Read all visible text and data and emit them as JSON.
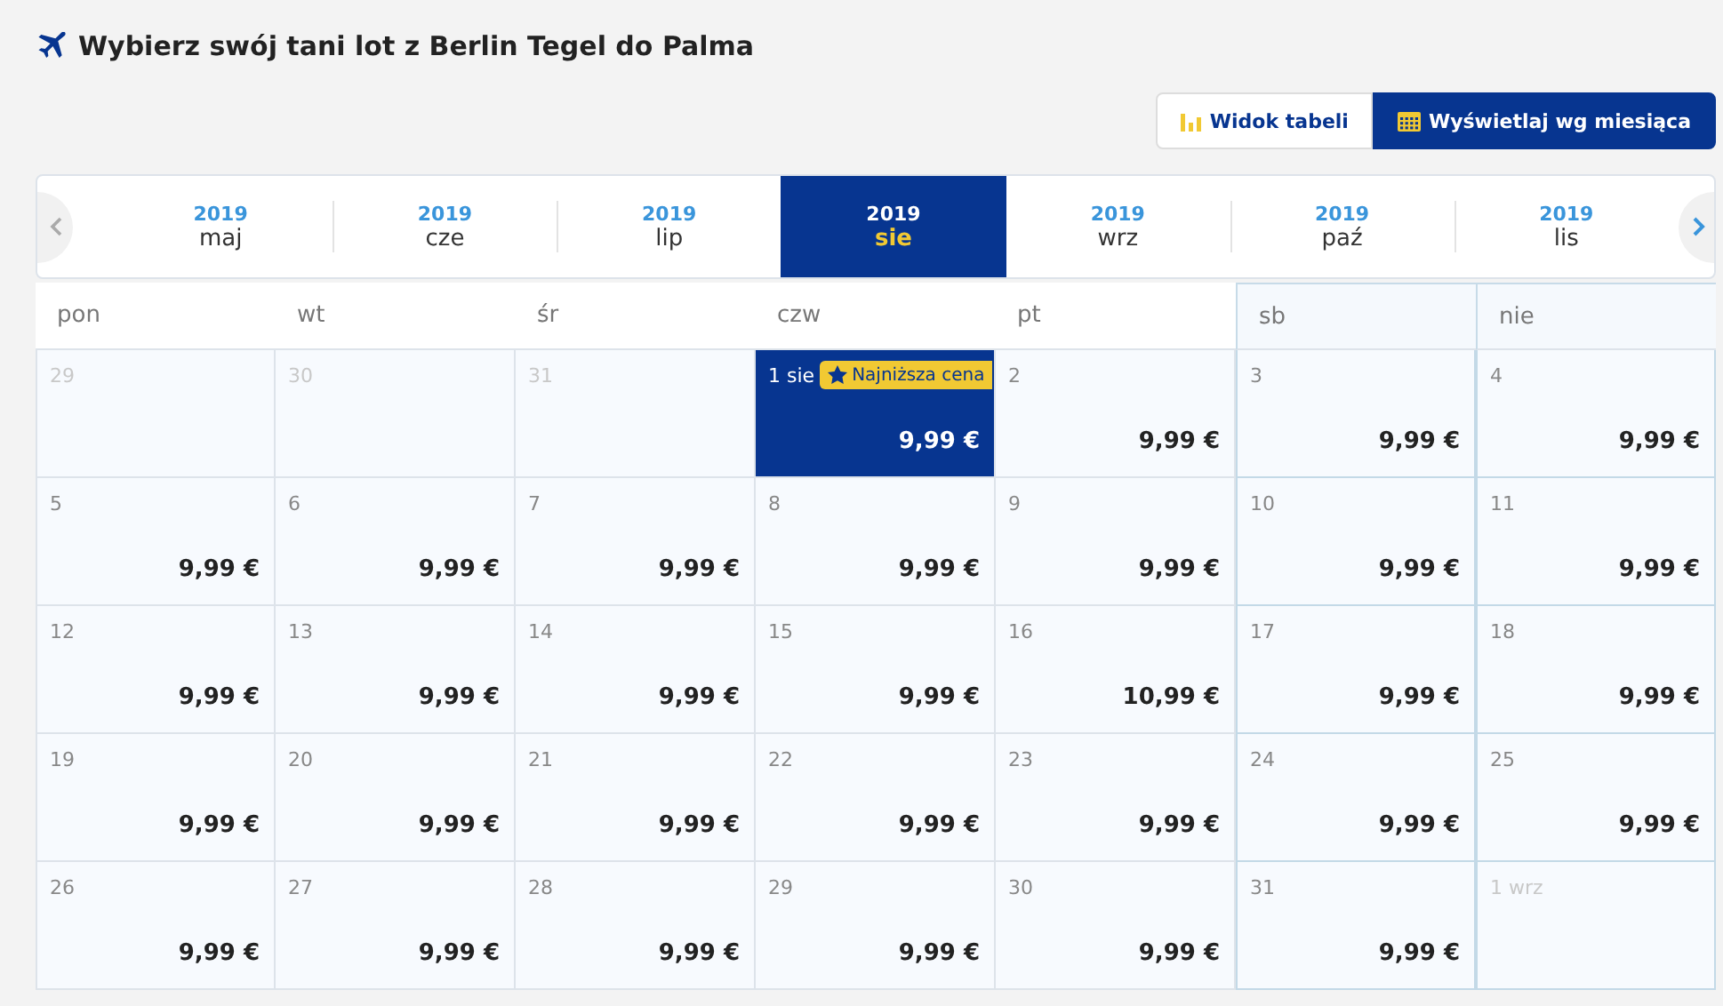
{
  "title": "Wybierz swój tani lot z Berlin Tegel do Palma",
  "view_toggle": [
    {
      "label": "Widok tabeli",
      "kind": "chart",
      "selected": false
    },
    {
      "label": "Wyświetlaj wg miesiąca",
      "kind": "calendar",
      "selected": true
    }
  ],
  "months": [
    {
      "year": "2019",
      "month": "maj",
      "selected": false
    },
    {
      "year": "2019",
      "month": "cze",
      "selected": false
    },
    {
      "year": "2019",
      "month": "lip",
      "selected": false
    },
    {
      "year": "2019",
      "month": "sie",
      "selected": true
    },
    {
      "year": "2019",
      "month": "wrz",
      "selected": false
    },
    {
      "year": "2019",
      "month": "paź",
      "selected": false
    },
    {
      "year": "2019",
      "month": "lis",
      "selected": false
    }
  ],
  "weekdays": [
    {
      "label": "pon",
      "weekend": false
    },
    {
      "label": "wt",
      "weekend": false
    },
    {
      "label": "śr",
      "weekend": false
    },
    {
      "label": "czw",
      "weekend": false
    },
    {
      "label": "pt",
      "weekend": false
    },
    {
      "label": "sb",
      "weekend": true
    },
    {
      "label": "nie",
      "weekend": true
    }
  ],
  "days": [
    {
      "date": "29",
      "muted": true,
      "selected": false
    },
    {
      "date": "30",
      "muted": true,
      "selected": false
    },
    {
      "date": "31",
      "muted": true,
      "selected": false
    },
    {
      "date": "1 sie",
      "muted": false,
      "selected": true,
      "badge": "Najniższa cena",
      "price": "9,99 €"
    },
    {
      "date": "2",
      "muted": false,
      "selected": false,
      "price": "9,99 €"
    },
    {
      "date": "3",
      "muted": false,
      "selected": false,
      "price": "9,99 €"
    },
    {
      "date": "4",
      "muted": false,
      "selected": false,
      "price": "9,99 €"
    },
    {
      "date": "5",
      "muted": false,
      "selected": false,
      "price": "9,99 €"
    },
    {
      "date": "6",
      "muted": false,
      "selected": false,
      "price": "9,99 €"
    },
    {
      "date": "7",
      "muted": false,
      "selected": false,
      "price": "9,99 €"
    },
    {
      "date": "8",
      "muted": false,
      "selected": false,
      "price": "9,99 €"
    },
    {
      "date": "9",
      "muted": false,
      "selected": false,
      "price": "9,99 €"
    },
    {
      "date": "10",
      "muted": false,
      "selected": false,
      "price": "9,99 €"
    },
    {
      "date": "11",
      "muted": false,
      "selected": false,
      "price": "9,99 €"
    },
    {
      "date": "12",
      "muted": false,
      "selected": false,
      "price": "9,99 €"
    },
    {
      "date": "13",
      "muted": false,
      "selected": false,
      "price": "9,99 €"
    },
    {
      "date": "14",
      "muted": false,
      "selected": false,
      "price": "9,99 €"
    },
    {
      "date": "15",
      "muted": false,
      "selected": false,
      "price": "9,99 €"
    },
    {
      "date": "16",
      "muted": false,
      "selected": false,
      "price": "10,99 €"
    },
    {
      "date": "17",
      "muted": false,
      "selected": false,
      "price": "9,99 €"
    },
    {
      "date": "18",
      "muted": false,
      "selected": false,
      "price": "9,99 €"
    },
    {
      "date": "19",
      "muted": false,
      "selected": false,
      "price": "9,99 €"
    },
    {
      "date": "20",
      "muted": false,
      "selected": false,
      "price": "9,99 €"
    },
    {
      "date": "21",
      "muted": false,
      "selected": false,
      "price": "9,99 €"
    },
    {
      "date": "22",
      "muted": false,
      "selected": false,
      "price": "9,99 €"
    },
    {
      "date": "23",
      "muted": false,
      "selected": false,
      "price": "9,99 €"
    },
    {
      "date": "24",
      "muted": false,
      "selected": false,
      "price": "9,99 €"
    },
    {
      "date": "25",
      "muted": false,
      "selected": false,
      "price": "9,99 €"
    },
    {
      "date": "26",
      "muted": false,
      "selected": false,
      "price": "9,99 €"
    },
    {
      "date": "27",
      "muted": false,
      "selected": false,
      "price": "9,99 €"
    },
    {
      "date": "28",
      "muted": false,
      "selected": false,
      "price": "9,99 €"
    },
    {
      "date": "29",
      "muted": false,
      "selected": false,
      "price": "9,99 €"
    },
    {
      "date": "30",
      "muted": false,
      "selected": false,
      "price": "9,99 €"
    },
    {
      "date": "31",
      "muted": false,
      "selected": false,
      "price": "9,99 €"
    },
    {
      "date": "1 wrz",
      "muted": true,
      "selected": false
    }
  ]
}
